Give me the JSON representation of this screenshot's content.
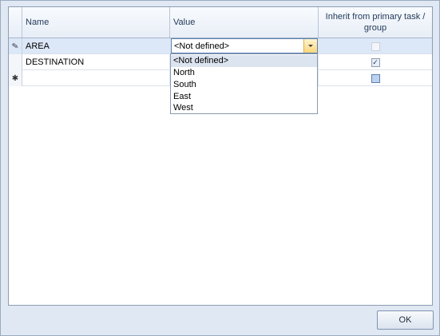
{
  "grid": {
    "columns": {
      "name": "Name",
      "value": "Value",
      "inherit": "Inherit from primary task / group"
    },
    "rows": [
      {
        "name": "AREA",
        "value": "<Not defined>",
        "inherit": false
      },
      {
        "name": "DESTINATION",
        "value": "",
        "inherit": true
      },
      {
        "name": "",
        "value": "",
        "inherit": null
      }
    ],
    "editor": {
      "selected": "<Not defined>",
      "options": [
        "<Not defined>",
        "North",
        "South",
        "East",
        "West"
      ]
    }
  },
  "icons": {
    "editing_row": "pencil-icon",
    "new_row": "asterisk-icon",
    "dropdown": "chevron-down-icon"
  },
  "colors": {
    "header_bg": "#f8fbfe",
    "selection_bg": "#dce7f7",
    "combo_button": "#f9d77d"
  },
  "footer": {
    "ok_label": "OK"
  }
}
